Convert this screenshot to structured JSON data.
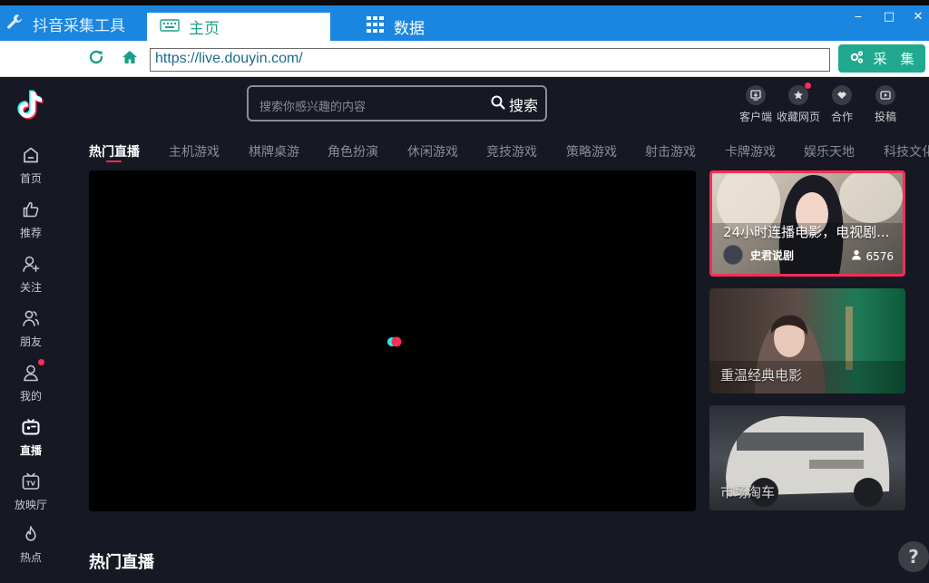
{
  "window": {
    "app_title": "抖音采集工具",
    "tabs": [
      {
        "label": "主页",
        "active": true
      },
      {
        "label": "数据",
        "active": false
      }
    ],
    "controls": {
      "minimize": "‒",
      "maximize": "□",
      "close": "✕"
    }
  },
  "addressbar": {
    "url": "https://live.douyin.com/",
    "collect_label": "采　集"
  },
  "sidebar": {
    "items": [
      {
        "label": "首页",
        "icon": "home-icon"
      },
      {
        "label": "推荐",
        "icon": "thumbs-up-icon"
      },
      {
        "label": "关注",
        "icon": "user-plus-icon"
      },
      {
        "label": "朋友",
        "icon": "friends-icon"
      },
      {
        "label": "我的",
        "icon": "profile-icon"
      },
      {
        "label": "直播",
        "icon": "live-icon",
        "active": true
      },
      {
        "label": "放映厅",
        "icon": "tv-icon"
      },
      {
        "label": "热点",
        "icon": "flame-icon"
      }
    ]
  },
  "header": {
    "search_placeholder": "搜索你感兴趣的内容",
    "search_button": "搜索",
    "actions": [
      {
        "label": "客户端",
        "icon": "download-icon"
      },
      {
        "label": "收藏网页",
        "icon": "star-icon"
      },
      {
        "label": "合作",
        "icon": "handshake-icon"
      },
      {
        "label": "投稿",
        "icon": "upload-video-icon"
      }
    ]
  },
  "categories": [
    "热门直播",
    "主机游戏",
    "棋牌桌游",
    "角色扮演",
    "休闲游戏",
    "竞技游戏",
    "策略游戏",
    "射击游戏",
    "卡牌游戏",
    "娱乐天地",
    "科技文化"
  ],
  "cards": [
    {
      "title": "24小时连播电影，电视剧...",
      "author": "史君说剧",
      "viewers": "6576",
      "selected": true
    },
    {
      "title": "重温经典电影"
    },
    {
      "title": "市场淘车"
    }
  ],
  "section_title": "热门直播",
  "help_label": "?",
  "colors": {
    "accent": "#fe2c55",
    "titlebar": "#1a86e0",
    "collect": "#20a98e",
    "background": "#161823"
  }
}
